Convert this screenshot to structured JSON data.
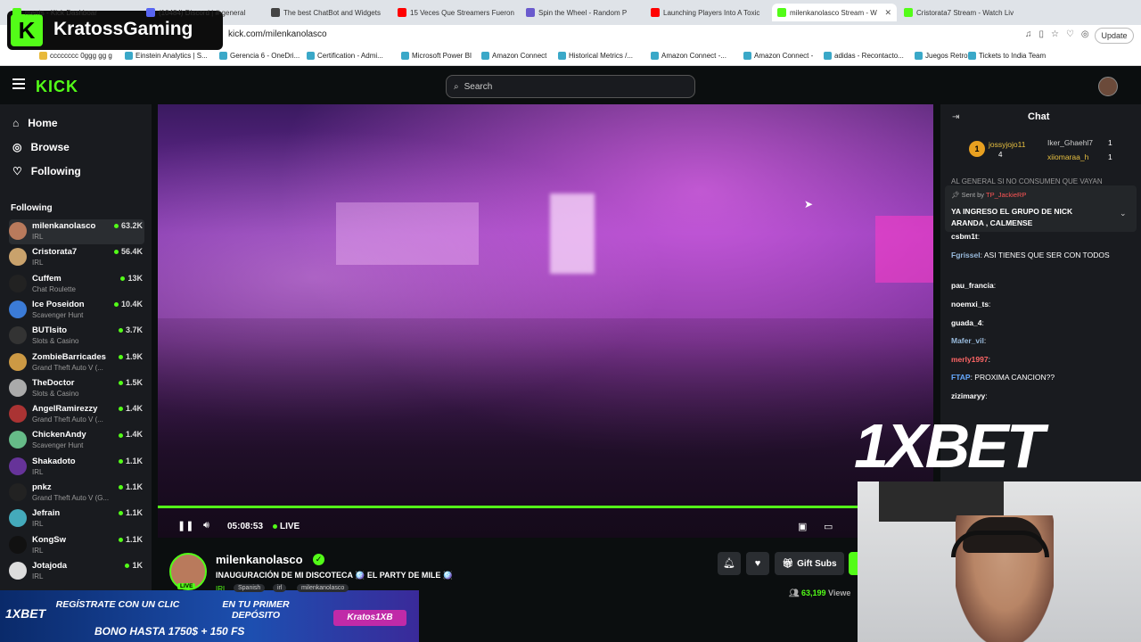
{
  "browser": {
    "tabs": [
      {
        "label": "ments - Kick Dashboar",
        "color": "#53fc18"
      },
      {
        "label": "(10484) Discord | #-general",
        "color": "#5865f2"
      },
      {
        "label": "The best ChatBot and Widgets",
        "color": "#444"
      },
      {
        "label": "15 Veces Que Streamers Fueron",
        "color": "#ff0000"
      },
      {
        "label": "Spin the Wheel - Random P",
        "color": "#6a5acd"
      },
      {
        "label": "Launching Players Into A Toxic",
        "color": "#ff0000"
      },
      {
        "label": "milenkanolasco Stream - W",
        "color": "#53fc18"
      },
      {
        "label": "Cristorata7 Stream - Watch Liv",
        "color": "#53fc18"
      }
    ],
    "url": "kick.com/milenkanolasco",
    "update_label": "Update",
    "bookmarks": [
      "cccccccc 0ggg gg g",
      "Einstein Analytics | S...",
      "Gerencia 6 - OneDri...",
      "Certification - Admi...",
      "Microsoft Power BI",
      "Amazon Connect",
      "Historical Metrics /...",
      "Amazon Connect -...",
      "Amazon Connect -",
      "adidas - Recontacto...",
      "Juegos Retro",
      "Tickets to India Team"
    ]
  },
  "overlay": {
    "brand": "KratossGaming"
  },
  "header": {
    "logo": "KICK",
    "search_placeholder": "Search"
  },
  "sidebar": {
    "nav": [
      {
        "label": "Home",
        "icon": "home-icon"
      },
      {
        "label": "Browse",
        "icon": "compass-icon"
      },
      {
        "label": "Following",
        "icon": "heart-icon"
      }
    ],
    "following_title": "Following",
    "following": [
      {
        "name": "milenkanolasco",
        "cat": "IRL",
        "views": "63.2K",
        "color": "#b97a5c"
      },
      {
        "name": "Cristorata7",
        "cat": "IRL",
        "views": "56.4K",
        "color": "#c9a26c"
      },
      {
        "name": "Cuffem",
        "cat": "Chat Roulette",
        "views": "13K",
        "color": "#222"
      },
      {
        "name": "Ice Poseidon",
        "cat": "Scavenger Hunt",
        "views": "10.4K",
        "color": "#3b7bd6"
      },
      {
        "name": "BUTIsito",
        "cat": "Slots & Casino",
        "views": "3.7K",
        "color": "#333"
      },
      {
        "name": "ZombieBarricades",
        "cat": "Grand Theft Auto V (...",
        "views": "1.9K",
        "color": "#c94"
      },
      {
        "name": "TheDoctor",
        "cat": "Slots & Casino",
        "views": "1.5K",
        "color": "#aaa"
      },
      {
        "name": "AngelRamirezzy",
        "cat": "Grand Theft Auto V (...",
        "views": "1.4K",
        "color": "#a33"
      },
      {
        "name": "ChickenAndy",
        "cat": "Scavenger Hunt",
        "views": "1.4K",
        "color": "#6b8"
      },
      {
        "name": "Shakadoto",
        "cat": "IRL",
        "views": "1.1K",
        "color": "#639"
      },
      {
        "name": "pnkz",
        "cat": "Grand Theft Auto V (G...",
        "views": "1.1K",
        "color": "#222"
      },
      {
        "name": "Jefrain",
        "cat": "IRL",
        "views": "1.1K",
        "color": "#4ab"
      },
      {
        "name": "KongSw",
        "cat": "IRL",
        "views": "1.1K",
        "color": "#111"
      },
      {
        "name": "Jotajoda",
        "cat": "IRL",
        "views": "1K",
        "color": "#ddd"
      }
    ]
  },
  "player": {
    "time": "05:08:53",
    "live": "LIVE"
  },
  "stream": {
    "name": "milenkanolasco",
    "title": "INAUGURACIÓN DE MI DISCOTECA 🪩 EL PARTY DE MILE 🪩",
    "tags": [
      "Spanish",
      "irl",
      "milenkanolasco"
    ],
    "category": "IRL",
    "live_badge": "LIVE",
    "gift": "Gift Subs",
    "viewers": "63,199",
    "viewers_suffix": "Viewe"
  },
  "chat": {
    "title": "Chat",
    "top": [
      {
        "name": "jossyjojo11",
        "count": "4"
      },
      {
        "name": "Iker_Ghaehl7",
        "count": "1"
      },
      {
        "name": "xiiomaraa_h",
        "count": "1"
      }
    ],
    "pinned_cut": "AL GENERAL SI NO CONSUMEN QUE VAYAN",
    "pinned_by": "Sent by",
    "pinned_user": "TP_JackieRP",
    "pinned_text": "YA INGRESO EL GRUPO DE NICK ARANDA , CALMENSE",
    "messages": [
      {
        "user": "csbm1t",
        "text": "",
        "color": "#fff"
      },
      {
        "user": "Fgrissel",
        "text": "ASI TIENES QUE SER CON TODOS",
        "color": "#9bd"
      },
      {
        "user": "pau_francia",
        "text": "",
        "color": "#fff"
      },
      {
        "user": "noemxi_ts",
        "text": "",
        "color": "#fff"
      },
      {
        "user": "guada_4",
        "text": "",
        "color": "#fff"
      },
      {
        "user": "Mafer_vil",
        "text": "",
        "color": "#9bd"
      },
      {
        "user": "merly1997",
        "text": "",
        "color": "#f66"
      },
      {
        "user": "FTAP",
        "text": "PROXIMA CANCION??",
        "color": "#6af"
      },
      {
        "user": "zizimaryy",
        "text": "",
        "color": "#fff"
      }
    ]
  },
  "promo": {
    "line1": "REGÍSTRATE CON UN CLIC",
    "line2": "EN TU PRIMER DEPÓSITO",
    "line3": "BONO HASTA 1750$ + 150 FS",
    "code": "Kratos1XB",
    "logo": "1XBET",
    "big_logo": "1XBET"
  }
}
